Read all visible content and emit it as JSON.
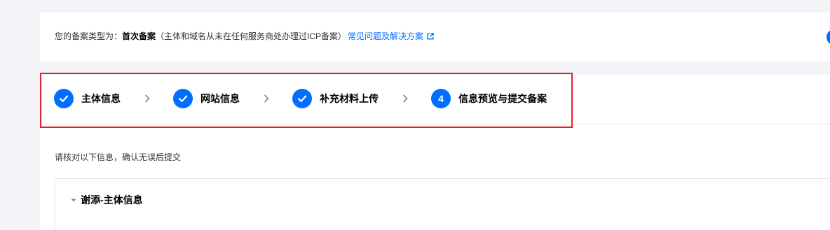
{
  "notice": {
    "prefix": "您的备案类型为：",
    "filing_type": "首次备案",
    "description": "（主体和域名从未在任何服务商处办理过ICP备案）",
    "faq_link": "常见问题及解决方案",
    "faq_link_icon": "external-link-icon"
  },
  "steps": [
    {
      "label": "主体信息",
      "status": "completed",
      "icon": "check-icon"
    },
    {
      "label": "网站信息",
      "status": "completed",
      "icon": "check-icon"
    },
    {
      "label": "补充材料上传",
      "status": "completed",
      "icon": "check-icon"
    },
    {
      "label": "信息预览与提交备案",
      "status": "current",
      "number": "4"
    }
  ],
  "step_separator_icon": "chevron-right-icon",
  "instruction": "请核对以下信息，确认无误后提交",
  "section": {
    "title": "谢添-主体信息",
    "toggle_icon": "caret-down-icon",
    "expanded": true
  },
  "colors": {
    "accent": "#006eff",
    "annotation": "#e0202d",
    "page_background": "#f3f4f7",
    "panel_background": "#ffffff",
    "separator": "#8a8a8a"
  }
}
